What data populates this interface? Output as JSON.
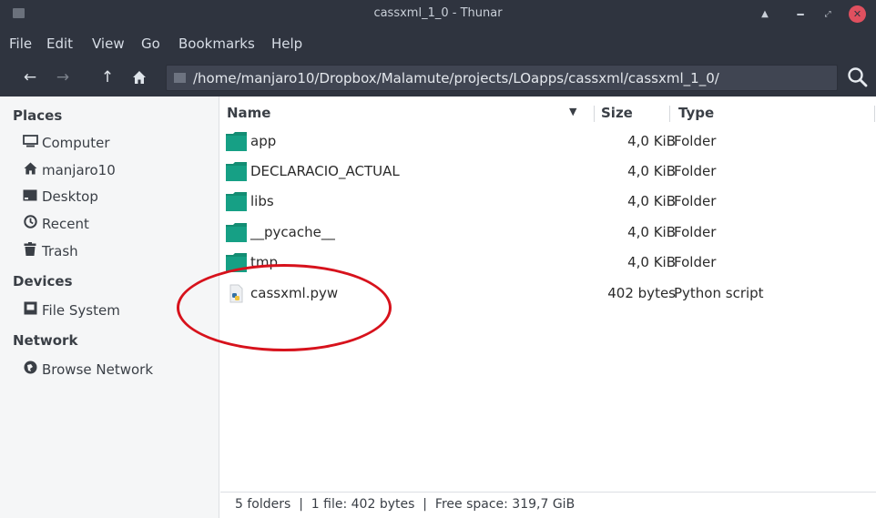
{
  "window": {
    "title": "cassxml_1_0 - Thunar"
  },
  "menu": [
    "File",
    "Edit",
    "View",
    "Go",
    "Bookmarks",
    "Help"
  ],
  "location": {
    "path": "/home/manjaro10/Dropbox/Malamute/projects/LOapps/cassxml/cassxml_1_0/"
  },
  "sidebar": {
    "places_label": "Places",
    "places": [
      {
        "label": "Computer",
        "icon": "computer-icon"
      },
      {
        "label": "manjaro10",
        "icon": "home-icon"
      },
      {
        "label": "Desktop",
        "icon": "desktop-icon"
      },
      {
        "label": "Recent",
        "icon": "recent-icon"
      },
      {
        "label": "Trash",
        "icon": "trash-icon"
      }
    ],
    "devices_label": "Devices",
    "devices": [
      {
        "label": "File System",
        "icon": "drive-icon"
      }
    ],
    "network_label": "Network",
    "network": [
      {
        "label": "Browse Network",
        "icon": "network-icon"
      }
    ]
  },
  "columns": {
    "name": "Name",
    "size": "Size",
    "type": "Type"
  },
  "files": [
    {
      "name": "app",
      "size": "4,0 KiB",
      "type": "Folder",
      "icon": "folder-icon"
    },
    {
      "name": "DECLARACIO_ACTUAL",
      "size": "4,0 KiB",
      "type": "Folder",
      "icon": "folder-icon"
    },
    {
      "name": "libs",
      "size": "4,0 KiB",
      "type": "Folder",
      "icon": "folder-icon"
    },
    {
      "name": "__pycache__",
      "size": "4,0 KiB",
      "type": "Folder",
      "icon": "folder-icon"
    },
    {
      "name": "tmp",
      "size": "4,0 KiB",
      "type": "Folder",
      "icon": "folder-icon"
    },
    {
      "name": "cassxml.pyw",
      "size": "402 bytes",
      "type": "Python script",
      "icon": "python-file-icon"
    }
  ],
  "status": "5 folders  |  1 file: 402 bytes  |  Free space: 319,7 GiB",
  "colors": {
    "titlebar": "#2f343f",
    "folder": "#16a085",
    "annotation": "#d7121c",
    "close_button": "#e0505f"
  }
}
